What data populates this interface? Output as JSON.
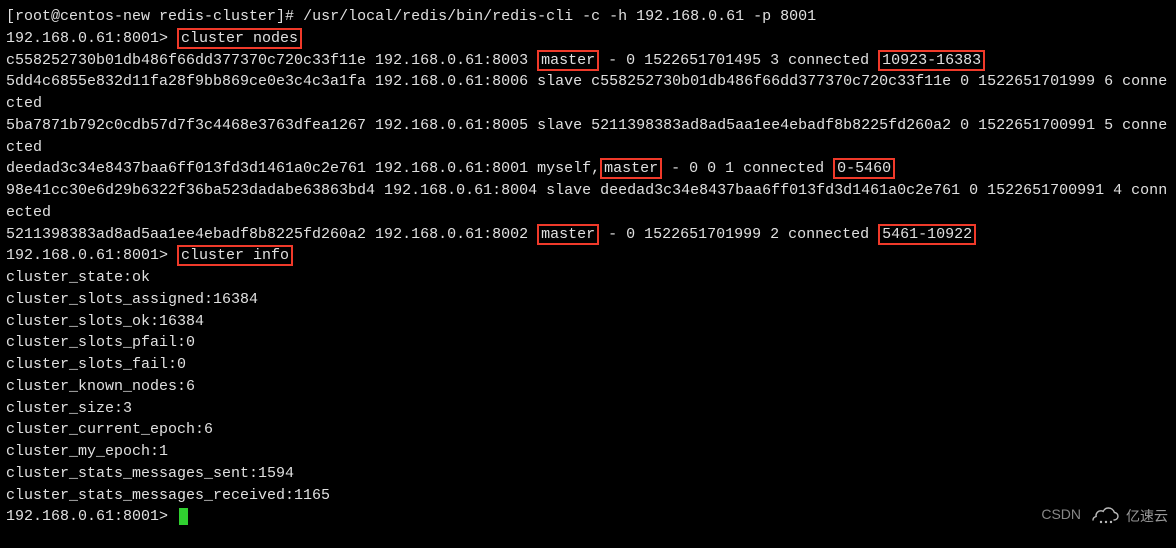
{
  "shell": {
    "prompt_root": "[root@centos-new redis-cluster]# ",
    "command1": "/usr/local/redis/bin/redis-cli -c -h 192.168.0.61 -p 8001",
    "redis_prompt": "192.168.0.61:8001> ",
    "cmd_cluster_nodes": "cluster nodes",
    "cmd_cluster_info": "cluster info"
  },
  "nodes": {
    "n1": {
      "id_host": "c558252730b01db486f66dd377370c720c33f11e 192.168.0.61:8003 ",
      "role": "master",
      "tail1": " - 0 1522651701495 3 connected ",
      "slots": "10923-16383"
    },
    "n2_full": "5dd4c6855e832d11fa28f9bb869ce0e3c4c3a1fa 192.168.0.61:8006 slave c558252730b01db486f66dd377370c720c33f11e 0 1522651701999 6 connected",
    "n3_full": "5ba7871b792c0cdb57d7f3c4468e3763dfea1267 192.168.0.61:8005 slave 5211398383ad8ad5aa1ee4ebadf8b8225fd260a2 0 1522651700991 5 connected",
    "n4": {
      "id_host": "deedad3c34e8437baa6ff013fd3d1461a0c2e761 192.168.0.61:8001 myself,",
      "role": "master",
      "tail1": " - 0 0 1 connected ",
      "slots": "0-5460"
    },
    "n5_full": "98e41cc30e6d29b6322f36ba523dadabe63863bd4 192.168.0.61:8004 slave deedad3c34e8437baa6ff013fd3d1461a0c2e761 0 1522651700991 4 connected",
    "n6": {
      "id_host": "5211398383ad8ad5aa1ee4ebadf8b8225fd260a2 192.168.0.61:8002 ",
      "role": "master",
      "tail1": " - 0 1522651701999 2 connected ",
      "slots": "5461-10922"
    }
  },
  "info": {
    "l1": "cluster_state:ok",
    "l2": "cluster_slots_assigned:16384",
    "l3": "cluster_slots_ok:16384",
    "l4": "cluster_slots_pfail:0",
    "l5": "cluster_slots_fail:0",
    "l6": "cluster_known_nodes:6",
    "l7": "cluster_size:3",
    "l8": "cluster_current_epoch:6",
    "l9": "cluster_my_epoch:1",
    "l10": "cluster_stats_messages_sent:1594",
    "l11": "cluster_stats_messages_received:1165"
  },
  "watermark": {
    "left": "CSDN ",
    "right": "亿速云"
  }
}
